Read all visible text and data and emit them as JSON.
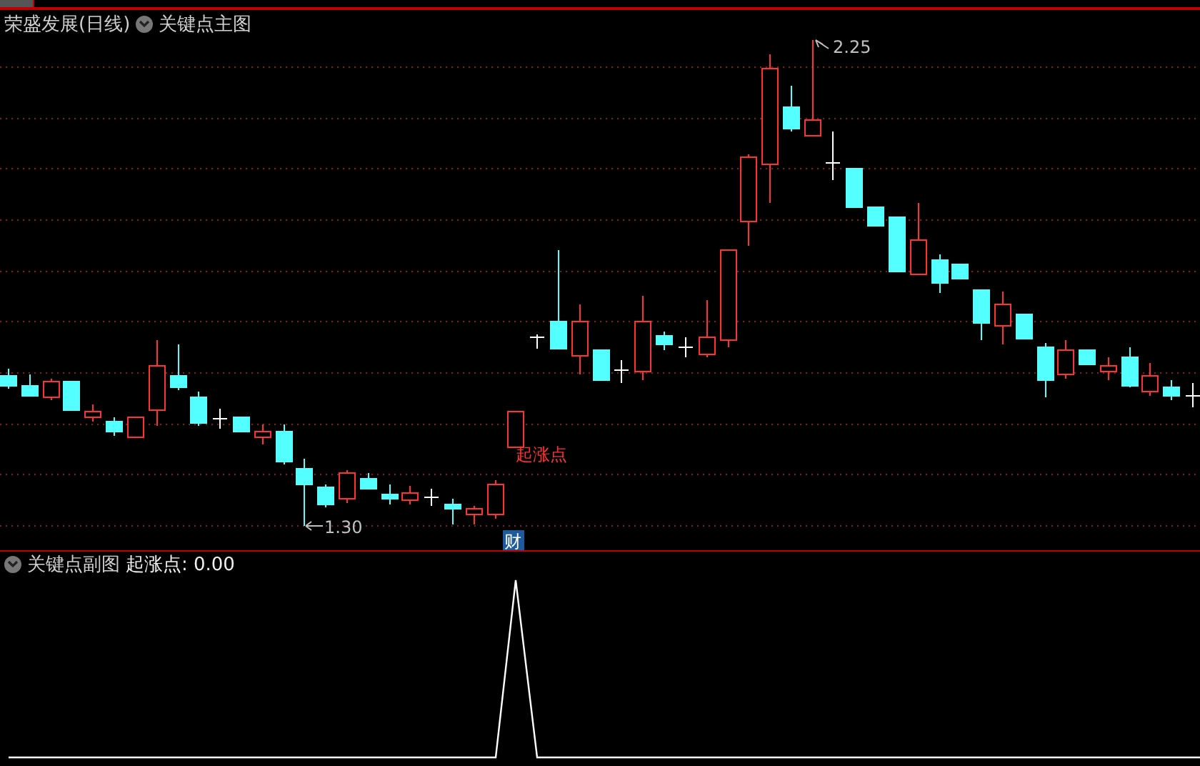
{
  "header": {
    "stock_title": "荣盛发展(日线)",
    "indicator": "关键点主图"
  },
  "main_chart": {
    "high_label": "2.25",
    "low_label": "1.30",
    "signal_label": "起涨点",
    "badge": "财"
  },
  "sub_panel": {
    "indicator": "关键点副图",
    "reading": "起涨点: 0.00"
  }
}
